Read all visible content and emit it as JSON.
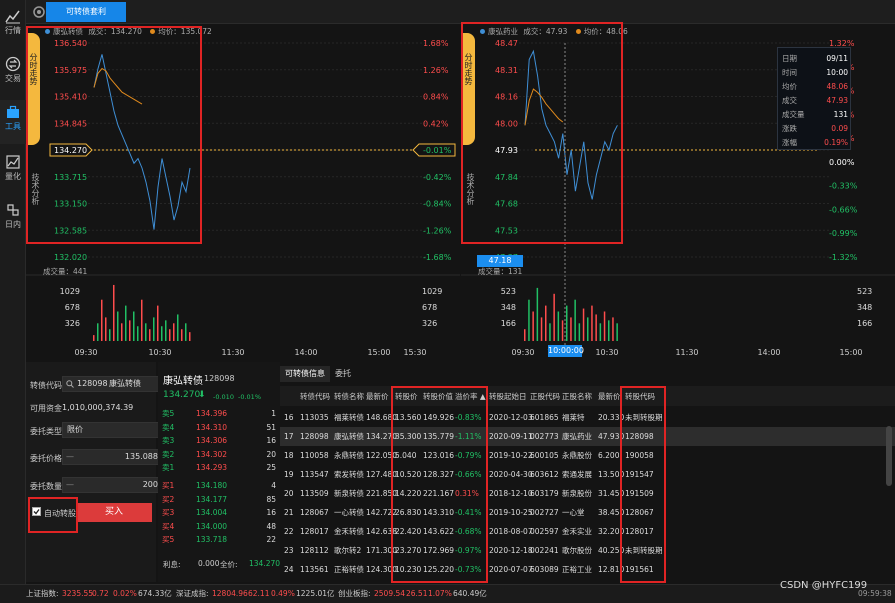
{
  "colors": {
    "up": "#ff4d4d",
    "down": "#21c065",
    "accent": "#1686e8",
    "price_line": "#3f8fd6",
    "avg_line": "#e08a1d"
  },
  "nav": [
    {
      "label": "行情",
      "icon": "chart-icon"
    },
    {
      "label": "交易",
      "icon": "exchange-icon"
    },
    {
      "label": "工具",
      "icon": "toolbox-icon"
    },
    {
      "label": "量化",
      "icon": "quant-icon"
    },
    {
      "label": "日内",
      "icon": "intraday-icon"
    }
  ],
  "top_tab": "可转债套利",
  "side_tab": {
    "active": "分时走势",
    "inactive": "技术分析"
  },
  "left_chart": {
    "series": [
      {
        "name": "康弘转债",
        "label": "成交：134.270"
      },
      {
        "name": "均价",
        "label": "均价：135.072"
      }
    ],
    "price_ticks": [
      "136.540",
      "135.975",
      "135.410",
      "134.845",
      "134.270",
      "133.715",
      "133.150",
      "132.585",
      "132.020"
    ],
    "pct_ticks": [
      "1.68%",
      "1.26%",
      "0.84%",
      "0.42%",
      "-0.01%",
      "-0.42%",
      "-0.84%",
      "-1.26%",
      "-1.68%"
    ],
    "ylim": [
      132.02,
      136.54
    ],
    "price": [
      135.6,
      136.0,
      136.3,
      135.9,
      135.5,
      135.1,
      134.8,
      134.6,
      134.4,
      134.2,
      134.0,
      134.1,
      133.9,
      133.6,
      133.2,
      132.6,
      133.5,
      134.1,
      133.7,
      133.3,
      132.8,
      133.1,
      133.6,
      133.4,
      133.9
    ],
    "avg": [
      135.6,
      135.9,
      136.0,
      135.95,
      135.8,
      135.7,
      135.6,
      135.5,
      135.45,
      135.4,
      135.35,
      135.3,
      135.25
    ],
    "vol_header": "成交量：441",
    "vol_ticks": [
      "1029",
      "678",
      "326"
    ],
    "vol_right": [
      "1029",
      "678",
      "326"
    ],
    "vol_values": [
      0.1,
      0.3,
      0.7,
      0.4,
      0.2,
      0.95,
      0.5,
      0.3,
      0.6,
      0.35,
      0.5,
      0.25,
      0.7,
      0.3,
      0.2,
      0.4,
      0.6,
      0.25,
      0.35,
      0.2,
      0.3,
      0.45,
      0.2,
      0.3,
      0.15
    ],
    "vol_up": [
      1,
      0,
      1,
      1,
      0,
      1,
      0,
      1,
      0,
      1,
      0,
      0,
      1,
      0,
      1,
      0,
      1,
      0,
      0,
      1,
      1,
      0,
      1,
      0,
      1
    ],
    "times": [
      "09:30",
      "10:30",
      "11:30",
      "14:00",
      "15:00",
      "15:30"
    ]
  },
  "right_chart": {
    "series": [
      {
        "name": "康弘药业",
        "label": "成交：47.93"
      },
      {
        "name": "均价",
        "label": "均价：48.06"
      }
    ],
    "price_ticks": [
      "48.47",
      "48.31",
      "48.16",
      "48.00",
      "47.93",
      "47.84",
      "47.68",
      "47.53",
      "47.37"
    ],
    "pct_ticks": [
      "1.32%",
      "0.99%",
      "0.66%",
      "0.33%",
      "0.19%",
      "0.00%",
      "-0.33%",
      "-0.66%",
      "-0.99%",
      "-1.32%"
    ],
    "ylim": [
      47.2,
      48.5
    ],
    "price": [
      48.0,
      48.4,
      48.45,
      48.3,
      48.1,
      48.0,
      47.95,
      47.9,
      47.8,
      47.95,
      47.7,
      47.85,
      47.6,
      47.75,
      47.9,
      47.65,
      47.55,
      47.7,
      47.8,
      47.9,
      47.85,
      47.95,
      48.0
    ],
    "avg": [
      48.0,
      48.15,
      48.22,
      48.2,
      48.17,
      48.13,
      48.1,
      48.07,
      48.04,
      48.02
    ],
    "vol_header": "成交量：131",
    "vol_ticks": [
      "523",
      "348",
      "166"
    ],
    "vol_right": [
      "523",
      "348",
      "166"
    ],
    "cursor_price": "47.18",
    "cursor_time": "10:00:00",
    "vol_values": [
      0.2,
      0.7,
      0.5,
      0.9,
      0.4,
      0.6,
      0.3,
      0.8,
      0.5,
      0.35,
      0.6,
      0.4,
      0.7,
      0.3,
      0.55,
      0.4,
      0.6,
      0.45,
      0.3,
      0.5,
      0.35,
      0.4,
      0.3
    ],
    "vol_up": [
      1,
      0,
      1,
      0,
      1,
      1,
      0,
      1,
      0,
      1,
      0,
      1,
      0,
      0,
      1,
      0,
      1,
      1,
      0,
      1,
      0,
      1,
      0
    ],
    "times": [
      "09:30",
      "10:00:00",
      "10:30",
      "11:30",
      "14:00",
      "15:00"
    ]
  },
  "info_box": [
    {
      "k": "日期",
      "v": "09/11",
      "c": "#fff"
    },
    {
      "k": "时间",
      "v": "10:00",
      "c": "#fff"
    },
    {
      "k": "均价",
      "v": "48.06",
      "c": "#ff4d4d"
    },
    {
      "k": "成交",
      "v": "47.93",
      "c": "#ff4d4d"
    },
    {
      "k": "成交量",
      "v": "131",
      "c": "#fff"
    },
    {
      "k": "涨跌",
      "v": "0.09",
      "c": "#ff4d4d"
    },
    {
      "k": "涨幅",
      "v": "0.19%",
      "c": "#ff4d4d"
    }
  ],
  "trade": {
    "code_label": "转债代码",
    "code_value": "128098",
    "code_name": "康弘转债",
    "funds_label": "可用资金",
    "funds_value": "1,010,000,374.39",
    "type_label": "委托类型",
    "type_value": "限价",
    "price_label": "委托价格",
    "price_value": "135.088",
    "qty_label": "委托数量",
    "qty_value": "200",
    "auto_label": "自动转股",
    "buy_label": "买入"
  },
  "orderbook": {
    "name": "康弘转债",
    "code": "128098",
    "price": "134.270",
    "chg": "-0.010",
    "pct": "-0.01%",
    "asks": [
      {
        "n": "卖5",
        "p": "134.396",
        "q": "1"
      },
      {
        "n": "卖4",
        "p": "134.310",
        "q": "51"
      },
      {
        "n": "卖3",
        "p": "134.306",
        "q": "16"
      },
      {
        "n": "卖2",
        "p": "134.302",
        "q": "20"
      },
      {
        "n": "卖1",
        "p": "134.293",
        "q": "25"
      }
    ],
    "bids": [
      {
        "n": "买1",
        "p": "134.180",
        "q": "4"
      },
      {
        "n": "买2",
        "p": "134.177",
        "q": "85"
      },
      {
        "n": "买3",
        "p": "134.004",
        "q": "16"
      },
      {
        "n": "买4",
        "p": "134.000",
        "q": "48"
      },
      {
        "n": "买5",
        "p": "133.718",
        "q": "22"
      }
    ],
    "profit_label": "利息:",
    "profit_value": "0.000",
    "last_label": "全价:",
    "last_value": "134.270"
  },
  "table": {
    "tabs": [
      "可转债信息",
      "委托"
    ],
    "headers": [
      "",
      "转债代码",
      "转债名称",
      "最新价",
      "转股价",
      "转股价值",
      "溢价率 ▲",
      "转股起始日",
      "正股代码",
      "正股名称",
      "最新价",
      "转股代码"
    ],
    "rows": [
      [
        "16",
        "113035",
        "福莱转债",
        "148.680",
        "13.560",
        "149.926",
        "-0.83%",
        "2020-12-03",
        "601865",
        "福莱特",
        "20.330",
        "未到转股期"
      ],
      [
        "17",
        "128098",
        "康弘转债",
        "134.270",
        "35.300",
        "135.779",
        "-1.11%",
        "2020-09-11",
        "002773",
        "康弘药业",
        "47.930",
        "128098"
      ],
      [
        "18",
        "110058",
        "永鼎转债",
        "122.050",
        "5.040",
        "123.016",
        "-0.79%",
        "2019-10-22",
        "600105",
        "永鼎股份",
        "6.200",
        "190058"
      ],
      [
        "19",
        "113547",
        "索发转债",
        "127.480",
        "10.520",
        "128.327",
        "-0.66%",
        "2020-04-30",
        "603612",
        "索通发展",
        "13.500",
        "191547"
      ],
      [
        "20",
        "113509",
        "新泉转债",
        "221.850",
        "14.220",
        "221.167",
        "0.31%",
        "2018-12-10",
        "603179",
        "新泉股份",
        "31.450",
        "191509"
      ],
      [
        "21",
        "128067",
        "一心转债",
        "142.722",
        "26.830",
        "143.310",
        "-0.41%",
        "2019-10-25",
        "002727",
        "一心堂",
        "38.450",
        "128067"
      ],
      [
        "22",
        "128017",
        "金禾转债",
        "142.638",
        "22.420",
        "143.622",
        "-0.68%",
        "2018-08-07",
        "002597",
        "金禾实业",
        "32.200",
        "128017"
      ],
      [
        "23",
        "128112",
        "歌尔转2",
        "171.300",
        "23.270",
        "172.969",
        "-0.97%",
        "2020-12-18",
        "002241",
        "歌尔股份",
        "40.250",
        "未到转股期"
      ],
      [
        "24",
        "113561",
        "正裕转债",
        "124.300",
        "10.230",
        "125.220",
        "-0.73%",
        "2020-07-07",
        "603089",
        "正裕工业",
        "12.810",
        "191561"
      ]
    ]
  },
  "status": {
    "sh_label": "上证指数:",
    "sh_value": "3235.55",
    "sh_chg": "0.72",
    "sh_pct": "0.02%",
    "sh_amt": "674.33亿",
    "sz_label": "深证成指:",
    "sz_value": "12804.96",
    "sz_chg": "62.11",
    "sz_pct": "0.49%",
    "sz_amt": "1225.01亿",
    "cy_label": "创业板指:",
    "cy_value": "2509.54",
    "cy_chg": "26.51",
    "cy_pct": "1.07%",
    "cy_amt": "640.49亿",
    "watermark": "CSDN @HYFC199",
    "clock": "09:59:38"
  }
}
